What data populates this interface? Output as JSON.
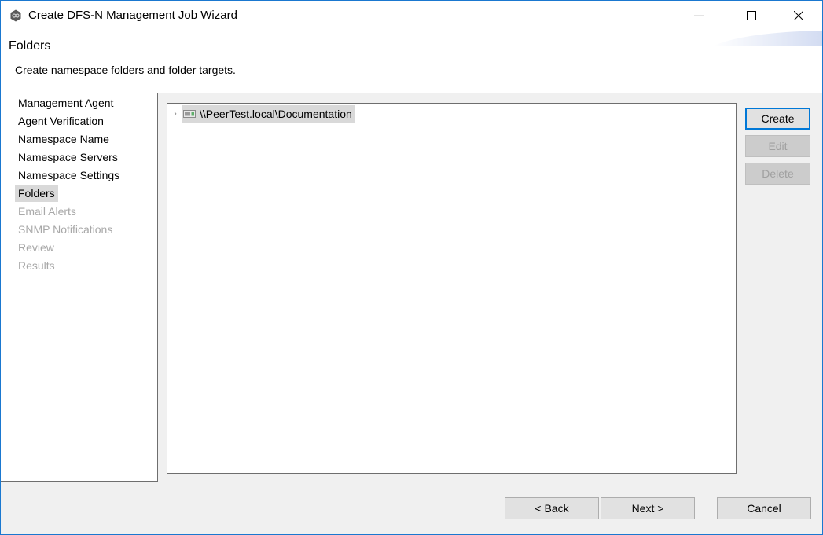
{
  "window": {
    "title": "Create DFS-N Management Job Wizard",
    "app_icon": "peer-logo-icon",
    "controls": {
      "minimize": "minimize-icon",
      "maximize": "maximize-icon",
      "close": "close-icon"
    }
  },
  "header": {
    "title": "Folders",
    "description": "Create namespace folders and folder targets."
  },
  "nav": {
    "items": [
      {
        "label": "Management Agent",
        "state": "normal"
      },
      {
        "label": "Agent Verification",
        "state": "normal"
      },
      {
        "label": "Namespace Name",
        "state": "normal"
      },
      {
        "label": "Namespace Servers",
        "state": "normal"
      },
      {
        "label": "Namespace Settings",
        "state": "normal"
      },
      {
        "label": "Folders",
        "state": "active"
      },
      {
        "label": "Email Alerts",
        "state": "disabled"
      },
      {
        "label": "SNMP Notifications",
        "state": "disabled"
      },
      {
        "label": "Review",
        "state": "disabled"
      },
      {
        "label": "Results",
        "state": "disabled"
      }
    ]
  },
  "tree": {
    "items": [
      {
        "label": "\\\\PeerTest.local\\Documentation",
        "expander": "chevron-right-icon",
        "icon": "namespace-server-icon",
        "selected": true
      }
    ]
  },
  "actions": {
    "create": "Create",
    "edit": "Edit",
    "delete": "Delete"
  },
  "footer": {
    "back": "< Back",
    "next": "Next >",
    "cancel": "Cancel"
  },
  "colors": {
    "window_border": "#1a78d0",
    "default_button_border": "#0078d7",
    "selection_bg": "#d9d9d9",
    "disabled_text": "#a8a8a8"
  }
}
